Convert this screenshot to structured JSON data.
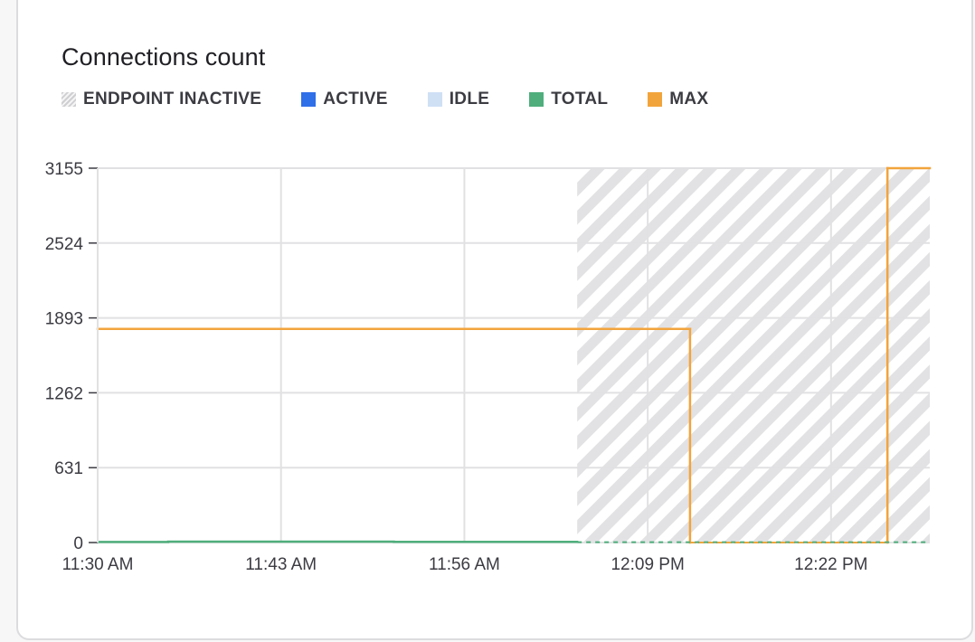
{
  "chart_data": {
    "type": "line",
    "title": "Connections count",
    "xlabel": "",
    "ylabel": "",
    "x_ticks": [
      "11:30 AM",
      "11:43 AM",
      "11:56 AM",
      "12:09 PM",
      "12:22 PM"
    ],
    "xlim_minutes_from_first_tick": [
      0,
      59
    ],
    "y_ticks": [
      0,
      631,
      1262,
      1893,
      2524,
      3155
    ],
    "ylim": [
      0,
      3155
    ],
    "grid": true,
    "legend_position": "top-left",
    "legend": [
      {
        "name": "ENDPOINT INACTIVE",
        "style": "hatch",
        "color": "#d4d4d6"
      },
      {
        "name": "ACTIVE",
        "color": "#2f6fe8"
      },
      {
        "name": "IDLE",
        "color": "#cfe0f5"
      },
      {
        "name": "TOTAL",
        "color": "#4fae7c"
      },
      {
        "name": "MAX",
        "color": "#f2a43c"
      }
    ],
    "inactive_regions": [
      {
        "start": "12:04 PM",
        "end": "12:29 PM"
      }
    ],
    "series": [
      {
        "name": "MAX",
        "color": "#f2a43c",
        "step": true,
        "points": [
          {
            "x": "11:30 AM",
            "y": 1800
          },
          {
            "x": "12:12 PM",
            "y": 1800
          },
          {
            "x": "12:12 PM",
            "y": 0
          },
          {
            "x": "12:26 PM",
            "y": 0
          },
          {
            "x": "12:26 PM",
            "y": 3155
          },
          {
            "x": "12:29 PM",
            "y": 3155
          }
        ]
      },
      {
        "name": "TOTAL",
        "color": "#4fae7c",
        "step": true,
        "points": [
          {
            "x": "11:30 AM",
            "y": 5
          },
          {
            "x": "11:35 AM",
            "y": 8
          },
          {
            "x": "11:51 AM",
            "y": 6
          },
          {
            "x": "12:04 PM",
            "y": 3
          },
          {
            "x": "12:26 PM",
            "y": 5
          },
          {
            "x": "12:29 PM",
            "y": 5
          }
        ]
      },
      {
        "name": "ACTIVE",
        "color": "#2f6fe8",
        "points": []
      },
      {
        "name": "IDLE",
        "color": "#cfe0f5",
        "points": []
      }
    ]
  }
}
